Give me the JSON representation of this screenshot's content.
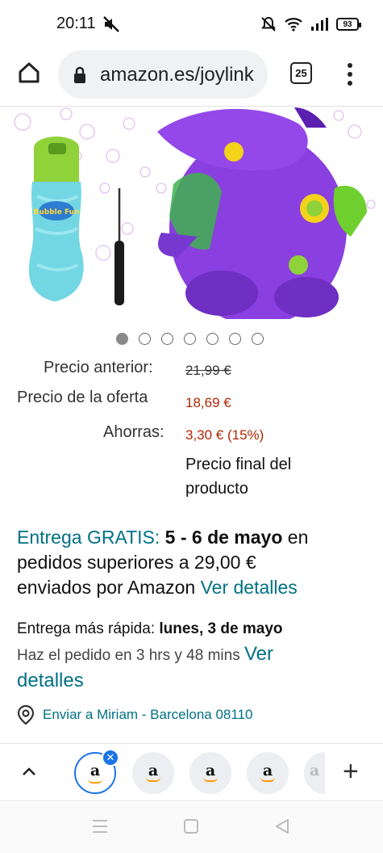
{
  "status_bar": {
    "time": "20:11",
    "battery": "93"
  },
  "browser": {
    "url": "amazon.es/joylink",
    "tab_count": "25"
  },
  "gallery": {
    "dot_count": 7,
    "active_index": 0,
    "bottle_label": "Bubble Fun"
  },
  "pricing": {
    "old_price_label": "Precio anterior:",
    "old_price": "21,99 €",
    "deal_price_label": "Precio de la oferta",
    "deal_price": "18,69 €",
    "savings_label": "Ahorras:",
    "savings": "3,30 € (15%)",
    "final_price_note_line1": "Precio final del",
    "final_price_note_line2": "producto"
  },
  "delivery": {
    "free_label": "Entrega GRATIS:",
    "dates": "5 - 6 de mayo",
    "text_after_dates": "en",
    "line2": "pedidos superiores a 29,00 €",
    "line3_prefix": "enviados por Amazon",
    "details_link": "Ver detalles"
  },
  "fast_delivery": {
    "label": "Entrega más rápida:",
    "date": "lunes, 3 de mayo",
    "order_within": "Haz el pedido en 3 hrs y 48 mins",
    "link_part1": "Ver",
    "link_part2": "detalles"
  },
  "shipping": {
    "text": "Enviar a Miriam - Barcelona 08110"
  },
  "tab_strip": {
    "tab_letter": "a"
  },
  "colors": {
    "link_teal": "#007185",
    "price_red": "#b12704",
    "tab_highlight": "#1a73e8"
  }
}
